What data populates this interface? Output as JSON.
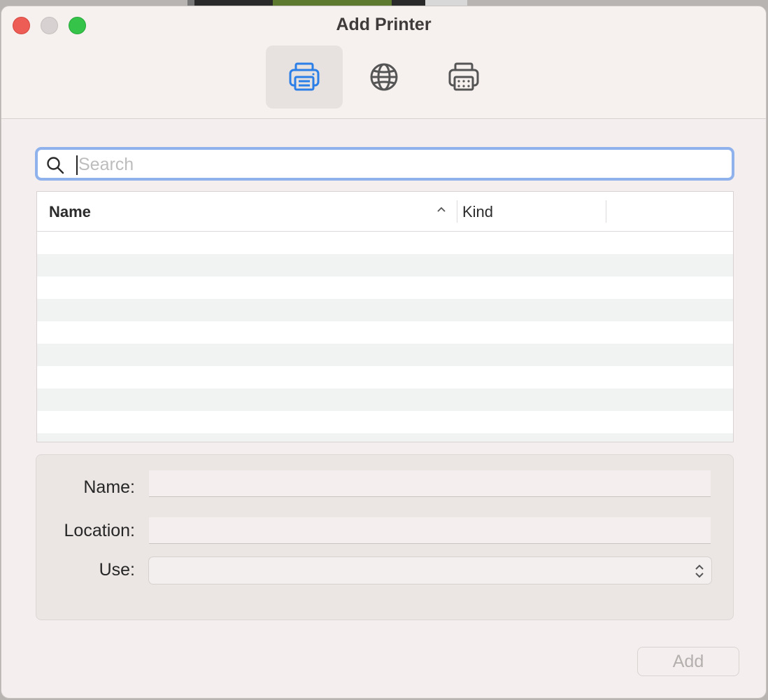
{
  "window": {
    "title": "Add Printer"
  },
  "toolbar": {
    "buttons": [
      {
        "icon": "printer-icon",
        "state": "selected",
        "color": "#2c7fe6"
      },
      {
        "icon": "globe-icon",
        "state": "normal",
        "color": "#555555"
      },
      {
        "icon": "windows-printer-icon",
        "state": "normal",
        "color": "#555555"
      }
    ]
  },
  "search": {
    "placeholder": "Search",
    "value": ""
  },
  "table": {
    "columns": [
      "Name",
      "Kind"
    ],
    "sort": {
      "column": "Name",
      "direction": "ascending"
    },
    "rows": []
  },
  "details": {
    "name_label": "Name:",
    "name_value": "",
    "location_label": "Location:",
    "location_value": "",
    "use_label": "Use:",
    "use_value": ""
  },
  "actions": {
    "add_label": "Add",
    "add_enabled": false
  },
  "colors": {
    "accent": "#2c7fe6",
    "focus_ring": "#8fb2ec",
    "close": "#ee5d55",
    "maximize": "#36c34a"
  }
}
